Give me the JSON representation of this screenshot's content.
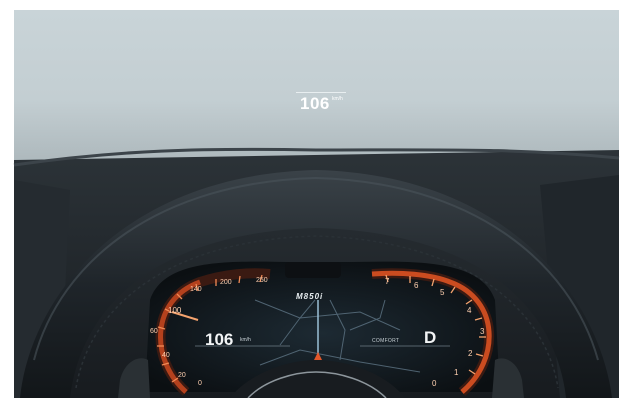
{
  "hud": {
    "speed": "106",
    "unit": "km/h"
  },
  "cluster": {
    "speed": "106",
    "speed_unit": "km/h",
    "gear": "D",
    "drive_mode": "COMFORT",
    "model_badge": "M850i",
    "speed_scale": [
      "0",
      "20",
      "40",
      "60",
      "100",
      "140",
      "200",
      "250"
    ],
    "rpm_scale": [
      "0",
      "1",
      "2",
      "3",
      "4",
      "5",
      "6",
      "7"
    ]
  },
  "colors": {
    "accent": "#e2572a",
    "windshield": "#c7d2d6",
    "dashboard": "#1d2227"
  }
}
